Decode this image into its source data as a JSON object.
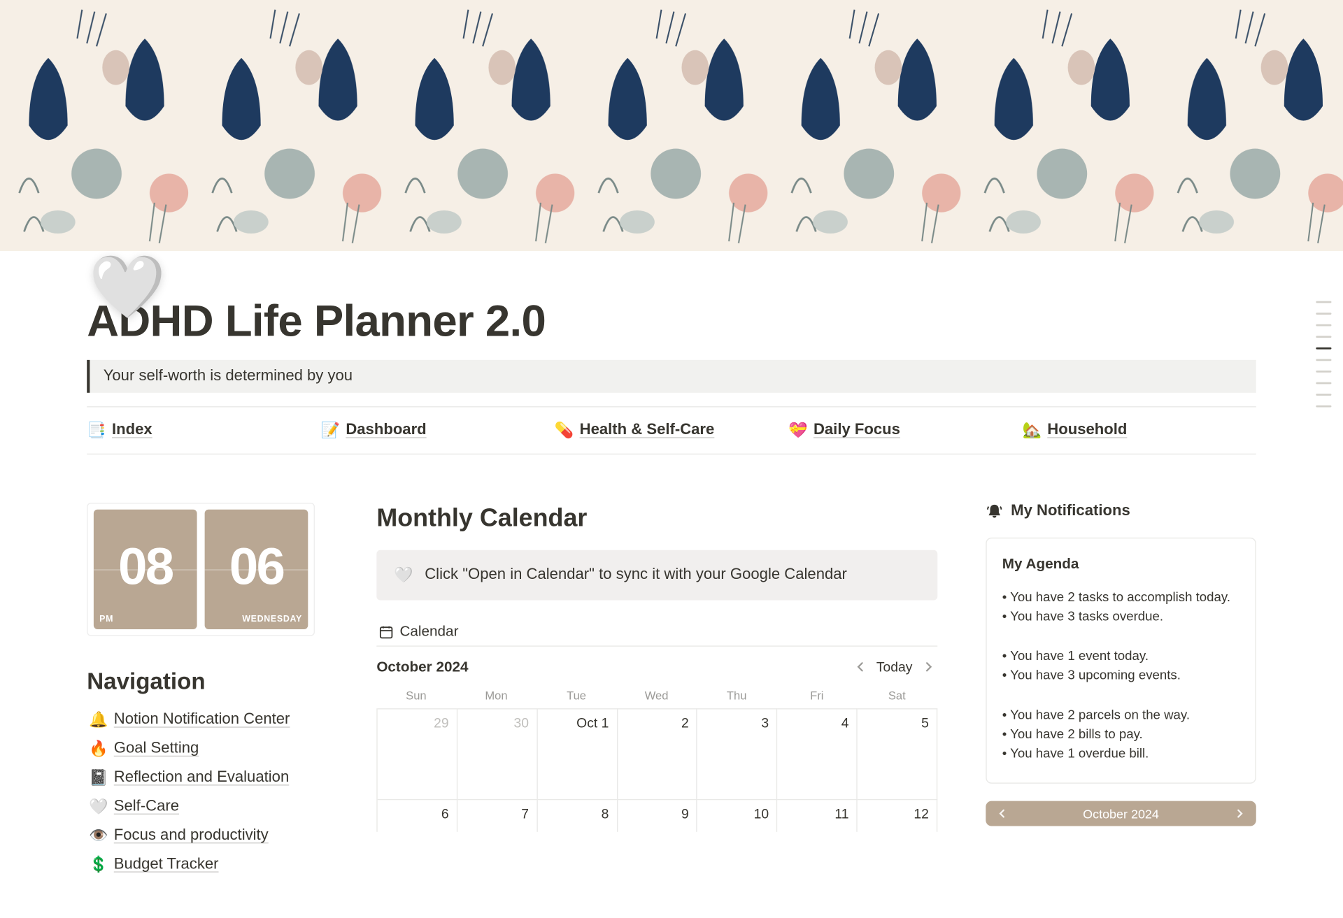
{
  "page": {
    "icon": "🤍",
    "title": "ADHD Life Planner 2.0",
    "quote": "Your self-worth is determined by you"
  },
  "topLinks": [
    {
      "emoji": "📑",
      "label": "Index"
    },
    {
      "emoji": "📝",
      "label": "Dashboard"
    },
    {
      "emoji": "💊",
      "label": "Health & Self-Care"
    },
    {
      "emoji": "💝",
      "label": "Daily Focus"
    },
    {
      "emoji": "🏡",
      "label": "Household"
    }
  ],
  "clock": {
    "hh": "08",
    "mm": "06",
    "ampm": "PM",
    "day": "WEDNESDAY"
  },
  "navigation": {
    "heading": "Navigation",
    "items": [
      {
        "emoji": "🔔",
        "label": "Notion Notification Center"
      },
      {
        "emoji": "🔥",
        "label": "Goal Setting"
      },
      {
        "emoji": "📓",
        "label": "Reflection and Evaluation"
      },
      {
        "emoji": "🤍",
        "label": "Self-Care"
      },
      {
        "emoji": "👁️",
        "label": "Focus and productivity"
      },
      {
        "emoji": "💲",
        "label": "Budget Tracker"
      }
    ]
  },
  "calendar": {
    "heading": "Monthly Calendar",
    "callout_icon": "🤍",
    "callout": "Click \"Open in Calendar\" to sync it with your Google Calendar",
    "tab": "Calendar",
    "month": "October 2024",
    "today": "Today",
    "dow": [
      "Sun",
      "Mon",
      "Tue",
      "Wed",
      "Thu",
      "Fri",
      "Sat"
    ],
    "row1": [
      "29",
      "30",
      "Oct 1",
      "2",
      "3",
      "4",
      "5"
    ],
    "row2": [
      "6",
      "7",
      "8",
      "9",
      "10",
      "11",
      "12"
    ]
  },
  "notifications": {
    "heading": "My Notifications",
    "agendaTitle": "My Agenda",
    "items1": [
      "• You have 2 tasks to accomplish today.",
      "• You have 3 tasks overdue."
    ],
    "items2": [
      "• You have 1 event today.",
      "• You have 3 upcoming events."
    ],
    "items3": [
      "• You have 2 parcels on the way.",
      "• You have 2 bills to pay.",
      "• You have 1 overdue bill."
    ],
    "miniMonth": "October 2024"
  }
}
